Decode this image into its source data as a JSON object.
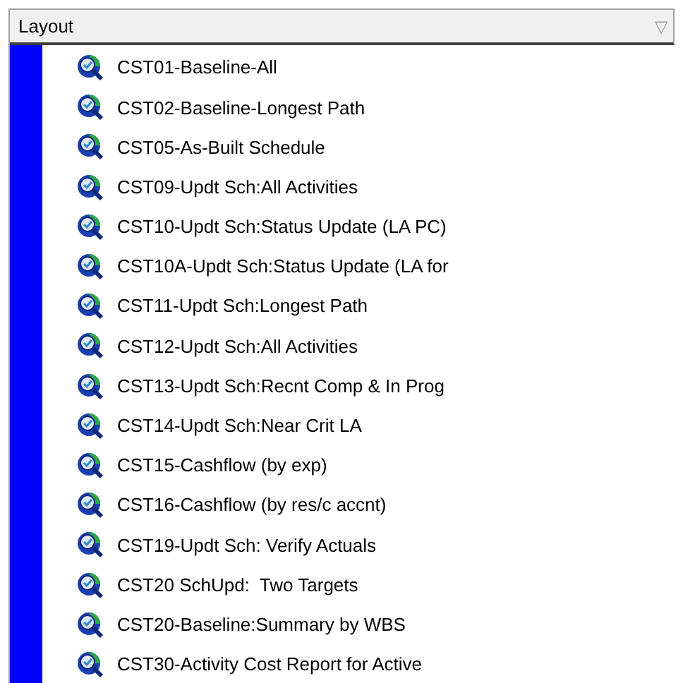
{
  "header": {
    "title": "Layout",
    "filter_glyph": "▽"
  },
  "items": [
    {
      "label": "CST01-Baseline-All"
    },
    {
      "label": "CST02-Baseline-Longest Path"
    },
    {
      "label": "CST05-As-Built Schedule"
    },
    {
      "label": "CST09-Updt Sch:All Activities"
    },
    {
      "label": "CST10-Updt Sch:Status Update (LA PC)"
    },
    {
      "label": "CST10A-Updt Sch:Status Update (LA for"
    },
    {
      "label": "CST11-Updt Sch:Longest Path"
    },
    {
      "label": "CST12-Updt Sch:All Activities"
    },
    {
      "label": "CST13-Updt Sch:Recnt Comp & In Prog"
    },
    {
      "label": "CST14-Updt Sch:Near Crit LA"
    },
    {
      "label": "CST15-Cashflow (by exp)"
    },
    {
      "label": "CST16-Cashflow (by res/c accnt)"
    },
    {
      "label": "CST19-Updt Sch: Verify Actuals"
    },
    {
      "label": "CST20 SchUpd:  Two Targets"
    },
    {
      "label": "CST20-Baseline:Summary by WBS"
    },
    {
      "label": "CST30-Activity Cost Report for Active"
    }
  ]
}
